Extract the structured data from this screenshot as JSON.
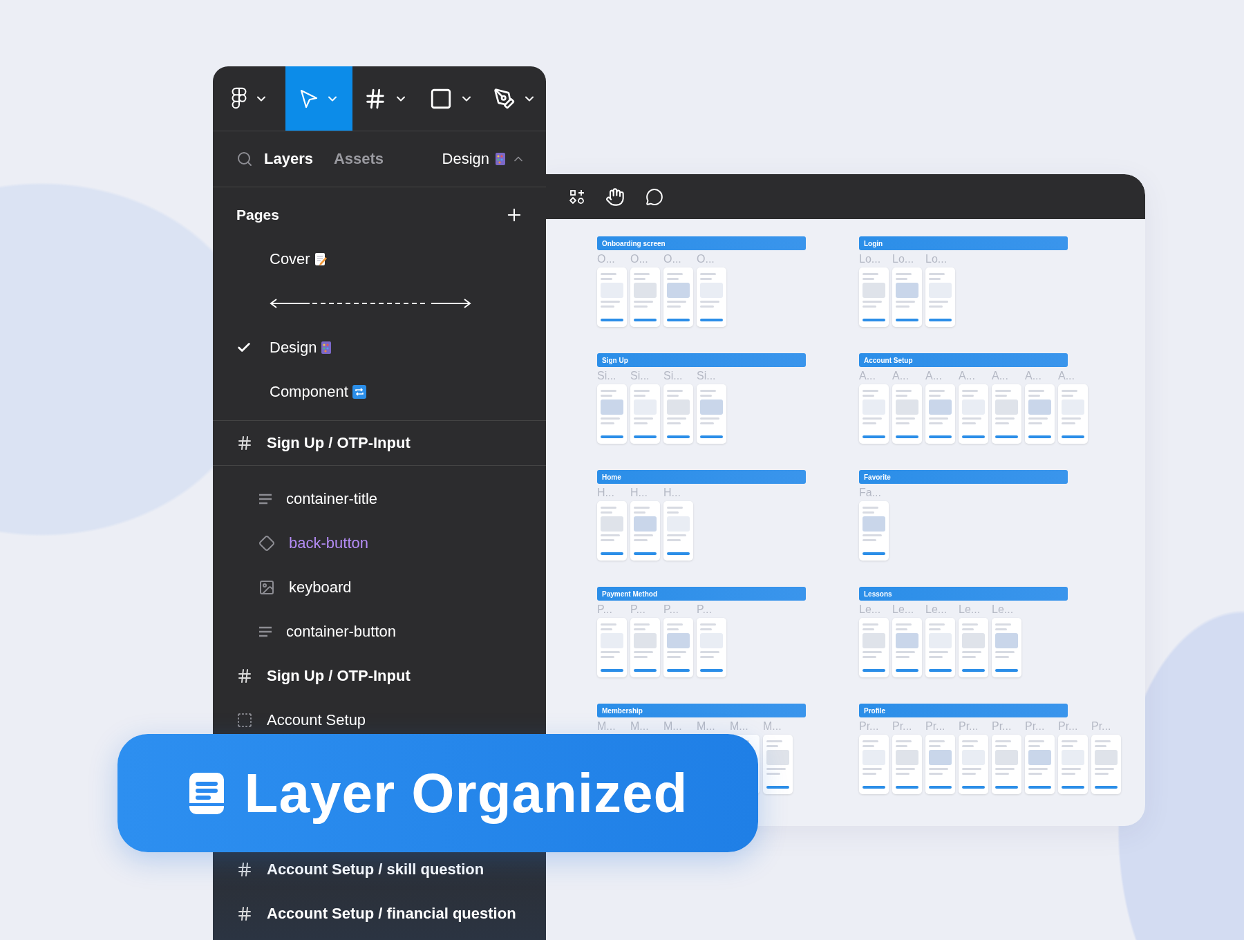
{
  "toolbar": {
    "tools": [
      {
        "kind": "logo",
        "selected": false
      },
      {
        "kind": "move",
        "selected": true
      },
      {
        "kind": "frame",
        "selected": false
      },
      {
        "kind": "shape",
        "selected": false
      },
      {
        "kind": "pen",
        "selected": false
      }
    ]
  },
  "panel_tabs": [
    {
      "label": "Layers",
      "selected": true
    },
    {
      "label": "Assets",
      "selected": false
    }
  ],
  "current_page": {
    "label": "Design",
    "kind": "design"
  },
  "pages": {
    "title": "Pages",
    "items": [
      {
        "kind": "doc",
        "label": "Cover",
        "selected": false
      },
      {
        "kind": "divider",
        "selected": false
      },
      {
        "kind": "design",
        "label": "Design",
        "selected": true
      },
      {
        "kind": "component",
        "label": "Component",
        "selected": false
      }
    ]
  },
  "layers": [
    {
      "kind": "frame",
      "label": "Sign Up / OTP-Input",
      "expanded": true,
      "children": [
        {
          "kind": "text",
          "label": "container-title"
        },
        {
          "kind": "component",
          "label": "back-button"
        },
        {
          "kind": "image",
          "label": "keyboard"
        },
        {
          "kind": "text",
          "label": "container-button"
        }
      ]
    },
    {
      "kind": "frame",
      "label": "Sign Up / OTP-Input",
      "expanded": false
    },
    {
      "kind": "group",
      "label": "Account Setup"
    },
    {
      "kind": "frame",
      "label": "Account Setup / skill question",
      "expanded": false
    },
    {
      "kind": "frame",
      "label": "Account Setup / financial question",
      "expanded": false
    }
  ],
  "canvas": {
    "sections": [
      {
        "title": "Onboarding screen",
        "frames": [
          "O...",
          "O...",
          "O...",
          "O..."
        ]
      },
      {
        "title": "Login",
        "frames": [
          "Lo...",
          "Lo...",
          "Lo..."
        ]
      },
      {
        "title": "Sign Up",
        "frames": [
          "Si...",
          "Si...",
          "Si...",
          "Si..."
        ]
      },
      {
        "title": "Account Setup",
        "frames": [
          "A...",
          "A...",
          "A...",
          "A...",
          "A...",
          "A...",
          "A..."
        ]
      },
      {
        "title": "Home",
        "frames": [
          "H...",
          "H...",
          "H..."
        ]
      },
      {
        "title": "Favorite",
        "frames": [
          "Fa..."
        ]
      },
      {
        "title": "Payment Method",
        "frames": [
          "P...",
          "P...",
          "P...",
          "P..."
        ]
      },
      {
        "title": "Lessons",
        "frames": [
          "Le...",
          "Le...",
          "Le...",
          "Le...",
          "Le..."
        ]
      },
      {
        "title": "Membership",
        "frames": [
          {
            "label": "M...",
            "kind": "label"
          },
          {
            "label": "M...",
            "kind": "label"
          },
          {
            "label": "M...",
            "kind": "label"
          },
          {
            "label": "M...",
            "kind": "label"
          },
          {
            "label": "M...",
            "kind": "screen"
          },
          {
            "label": "M...",
            "kind": "screen"
          }
        ]
      },
      {
        "title": "Profile",
        "frames": [
          "Pr...",
          "Pr...",
          "Pr...",
          "Pr...",
          "Pr...",
          "Pr...",
          "Pr...",
          "Pr..."
        ]
      }
    ]
  },
  "banner": {
    "title": "Layer Organized"
  }
}
